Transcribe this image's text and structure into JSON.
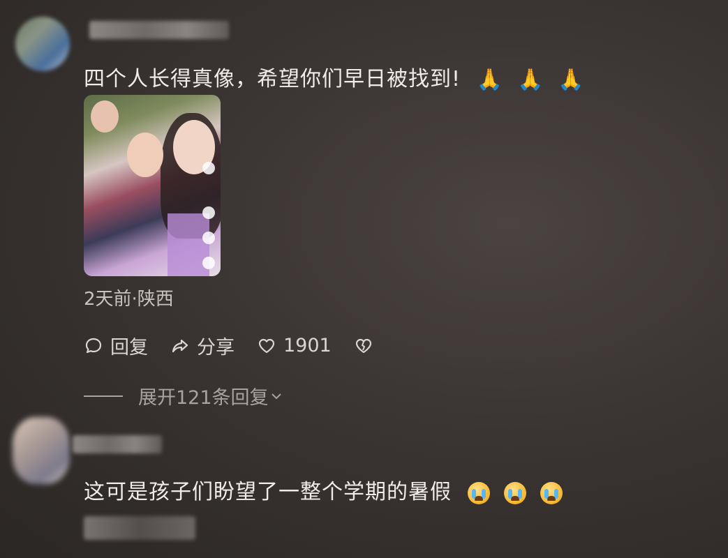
{
  "comment1": {
    "text": "四个人长得真像，希望你们早日被找到!",
    "emojis": [
      "pray-emoji",
      "pray-emoji",
      "pray-emoji"
    ],
    "meta": "2天前·陕西",
    "actions": {
      "reply_label": "回复",
      "share_label": "分享",
      "like_count": "1901"
    },
    "expand_label": "展开121条回复"
  },
  "comment2": {
    "text": "这可是孩子们盼望了一整个学期的暑假",
    "emojis": [
      "crying-face-emoji",
      "crying-face-emoji",
      "crying-face-emoji"
    ]
  },
  "colors": {
    "background": "#3a3432",
    "text": "#f0ece9",
    "secondary_text": "#c9c3bf"
  }
}
